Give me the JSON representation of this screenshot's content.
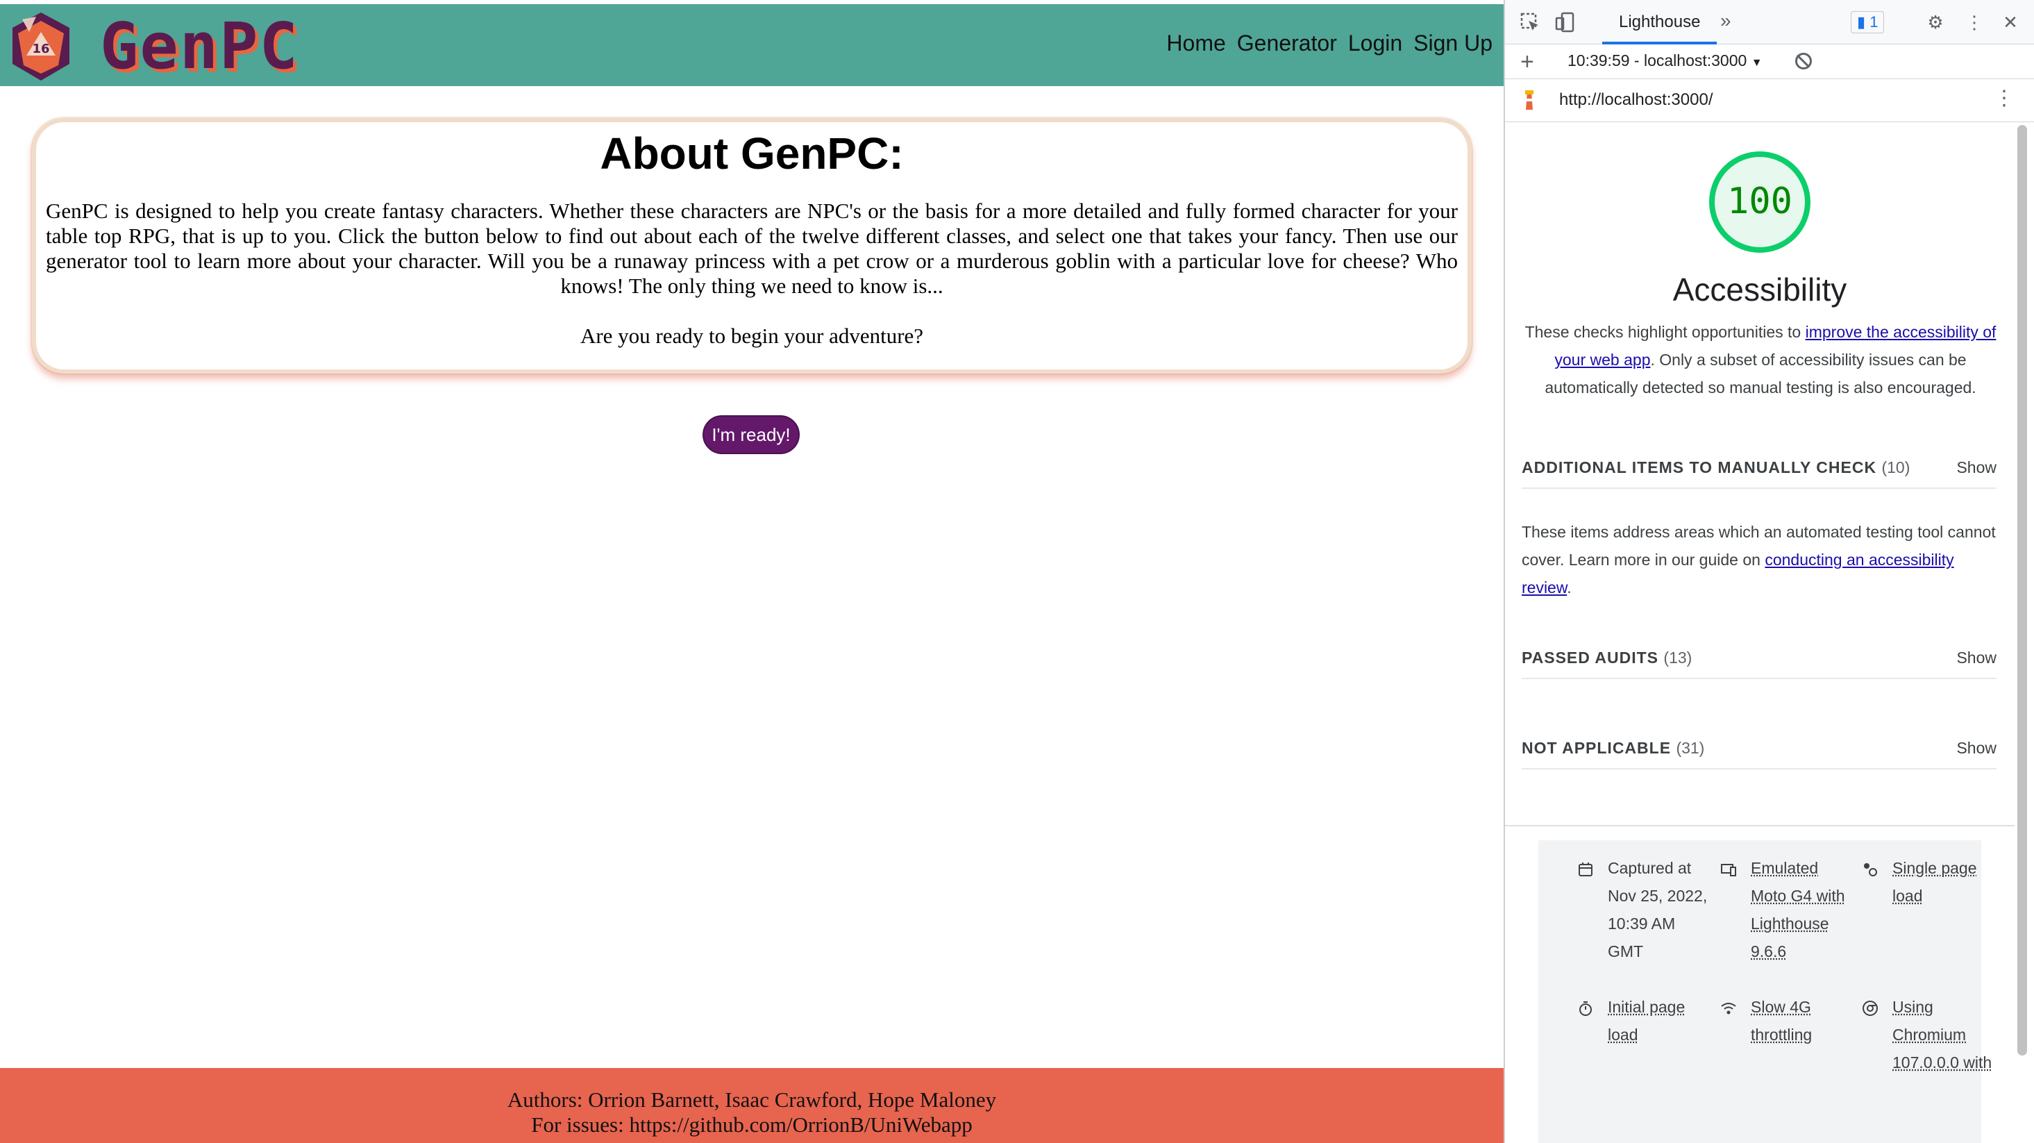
{
  "site": {
    "logo_text": "GenPC",
    "die_number": "16",
    "nav": [
      "Home",
      "Generator",
      "Login",
      "Sign Up"
    ],
    "about_title": "About GenPC:",
    "about_body": "GenPC is designed to help you create fantasy characters. Whether these characters are NPC's or the basis for a more detailed and fully formed character for your table top RPG, that is up to you. Click the button below to find out about each of the twelve different classes, and select one that takes your fancy. Then use our generator tool to learn more about your character. Will you be a runaway princess with a pet crow or a murderous goblin with a particular love for cheese? Who knows! The only thing we need to know is...",
    "about_question": "Are you ready to begin your adventure?",
    "ready_button": "I'm ready!",
    "footer_authors": "Authors: Orrion Barnett, Isaac Crawford, Hope Maloney",
    "footer_issues": "For issues: https://github.com/OrrionB/UniWebapp"
  },
  "devtools": {
    "tab_label": "Lighthouse",
    "more_tabs": "»",
    "issues_count": "1",
    "report_select": "10:39:59 - localhost:3000",
    "url": "http://localhost:3000/",
    "score": "100",
    "category_title": "Accessibility",
    "desc_pre": "These checks highlight opportunities to ",
    "desc_link": "improve the accessibility of your web app",
    "desc_post": ". Only a subset of accessibility issues can be automatically detected so manual testing is also encouraged.",
    "groups": [
      {
        "title": "ADDITIONAL ITEMS TO MANUALLY CHECK",
        "count": "(10)",
        "action": "Show"
      },
      {
        "title": "PASSED AUDITS",
        "count": "(13)",
        "action": "Show"
      },
      {
        "title": "NOT APPLICABLE",
        "count": "(31)",
        "action": "Show"
      }
    ],
    "manual_pre": "These items address areas which an automated testing tool cannot cover. Learn more in our guide on ",
    "manual_link": "conducting an accessibility review",
    "manual_post": ".",
    "env": [
      {
        "icon": "calendar-icon",
        "text": "Captured at Nov 25, 2022, 10:39 AM GMT"
      },
      {
        "icon": "devices-icon",
        "text": "Emulated Moto G4 with Lighthouse 9.6.6"
      },
      {
        "icon": "single-load-icon",
        "text": "Single page load"
      },
      {
        "icon": "timer-icon",
        "text": "Initial page load"
      },
      {
        "icon": "signal-icon",
        "text": "Slow 4G throttling"
      },
      {
        "icon": "chrome-icon",
        "text": "Using Chromium 107.0.0.0 with"
      }
    ]
  },
  "colors": {
    "header": "#4fa596",
    "footer": "#e7644f",
    "button": "#63186a",
    "logo": "#5a1c4e",
    "score_ring": "#0cce6b"
  }
}
